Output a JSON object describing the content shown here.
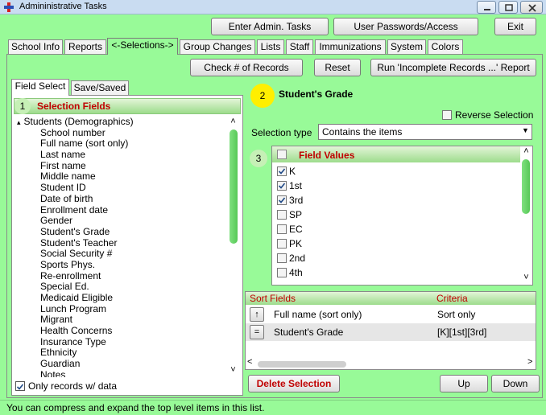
{
  "window": {
    "title": "Admininistrative Tasks"
  },
  "toolbar": {
    "enter_admin": "Enter Admin. Tasks",
    "user_passwords": "User Passwords/Access",
    "exit": "Exit"
  },
  "tabs": [
    {
      "label": "School Info"
    },
    {
      "label": "Reports"
    },
    {
      "label": "<-Selections->"
    },
    {
      "label": "Group Changes"
    },
    {
      "label": "Lists"
    },
    {
      "label": "Staff"
    },
    {
      "label": "Immunizations"
    },
    {
      "label": "System"
    },
    {
      "label": "Colors"
    }
  ],
  "actions": {
    "check_records": "Check # of Records",
    "reset": "Reset",
    "run_report": "Run 'Incomplete Records ...' Report"
  },
  "subtabs": [
    {
      "label": "Field Select"
    },
    {
      "label": "Save/Saved"
    }
  ],
  "selection_fields": {
    "step": "1",
    "title": "Selection Fields",
    "parent": "Students (Demographics)",
    "expander": "▴",
    "items": [
      "School number",
      "Full name (sort only)",
      "Last name",
      "First name",
      "Middle name",
      "Student ID",
      "Date of birth",
      "Enrollment date",
      "Gender",
      "Student's Grade",
      "Student's Teacher",
      "Social Security #",
      "Sports Phys.",
      "Re-enrollment",
      "Special Ed.",
      "Medicaid Eligible",
      "Lunch Program",
      "Migrant",
      "Health Concerns",
      "Insurance Type",
      "Ethnicity",
      "Guardian",
      "Notes"
    ],
    "only_records_label": "Only records w/ data",
    "only_records_checked": true
  },
  "field": {
    "step": "2",
    "name": "Student's Grade",
    "reverse_label": "Reverse Selection",
    "selection_type_label": "Selection type",
    "selection_type_value": "Contains the items"
  },
  "field_values": {
    "step": "3",
    "header": "Field Values",
    "items": [
      {
        "label": "K",
        "checked": true
      },
      {
        "label": "1st",
        "checked": true
      },
      {
        "label": "3rd",
        "checked": true
      },
      {
        "label": "SP",
        "checked": false
      },
      {
        "label": "EC",
        "checked": false
      },
      {
        "label": "PK",
        "checked": false
      },
      {
        "label": "2nd",
        "checked": false
      },
      {
        "label": "4th",
        "checked": false
      }
    ]
  },
  "scroll": {
    "up": "˄",
    "down": "˅",
    "left": "<",
    "right": ">"
  },
  "sort_grid": {
    "headers": {
      "sort": "Sort",
      "fields": "Fields",
      "criteria": "Criteria"
    },
    "rows": [
      {
        "button": "↑",
        "field": "Full name (sort only)",
        "criteria": "Sort only"
      },
      {
        "button": "=",
        "field": "Student's Grade",
        "criteria": "[K][1st][3rd]"
      }
    ]
  },
  "bottom": {
    "delete": "Delete Selection",
    "up": "Up",
    "down": "Down"
  },
  "status": "You can compress and expand the top level items in this list.",
  "colors": {
    "panel_green": "#98fa98",
    "header_red": "#c00000",
    "step_yellow": "#ffef00"
  }
}
